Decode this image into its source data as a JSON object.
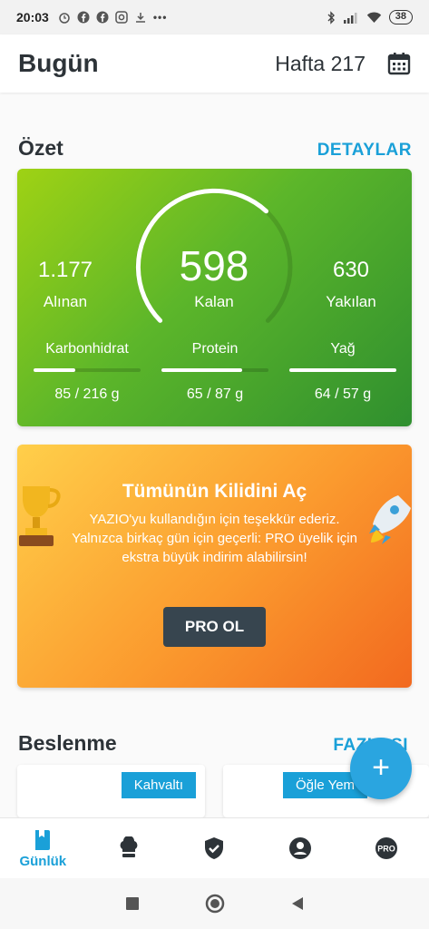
{
  "status_bar": {
    "time": "20:03",
    "battery": "38",
    "icons": [
      "alarm-icon",
      "facebook-icon",
      "facebook-icon",
      "instagram-icon",
      "download-icon",
      "more-icon"
    ],
    "right_icons": [
      "bluetooth-icon",
      "signal-icon",
      "wifi-icon",
      "battery-icon"
    ]
  },
  "app_bar": {
    "title": "Bugün",
    "week": "Hafta 217",
    "calendar_icon": "calendar-icon"
  },
  "summary_section": {
    "title": "Özet",
    "link": "DETAYLAR"
  },
  "summary": {
    "eaten_value": "1.177",
    "eaten_label": "Alınan",
    "remaining_value": "598",
    "remaining_label": "Kalan",
    "burned_value": "630",
    "burned_label": "Yakılan",
    "ring_progress": 0.66,
    "macros": [
      {
        "name": "Karbonhidrat",
        "value": "85 / 216 g",
        "progress": 0.39
      },
      {
        "name": "Protein",
        "value": "65 / 87 g",
        "progress": 0.75
      },
      {
        "name": "Yağ",
        "value": "64 / 57 g",
        "progress": 1.0
      }
    ],
    "colors": {
      "start": "#9fd214",
      "end": "#2f8f2f"
    }
  },
  "promo": {
    "title": "Tümünün Kilidini Aç",
    "text": "YAZIO'yu kullandığın için teşekkür ederiz. Yalnızca birkaç gün için geçerli: PRO üyelik için ekstra büyük indirim alabilirsin!",
    "button": "PRO OL",
    "left_icon": "trophy-icon",
    "right_icon": "rocket-icon"
  },
  "nutrition_section": {
    "title": "Beslenme",
    "link": "FAZLASI"
  },
  "meals": [
    {
      "label": "Kahvaltı"
    },
    {
      "label": "Öğle Yem"
    }
  ],
  "fab": {
    "label": "+"
  },
  "bottom_nav": {
    "items": [
      {
        "icon": "diary-icon",
        "label": "Günlük",
        "active": true
      },
      {
        "icon": "chef-hat-icon",
        "label": ""
      },
      {
        "icon": "shield-check-icon",
        "label": ""
      },
      {
        "icon": "profile-icon",
        "label": ""
      },
      {
        "icon": "pro-icon",
        "label": "PRO"
      }
    ]
  },
  "accent_color": "#1aa0d8"
}
